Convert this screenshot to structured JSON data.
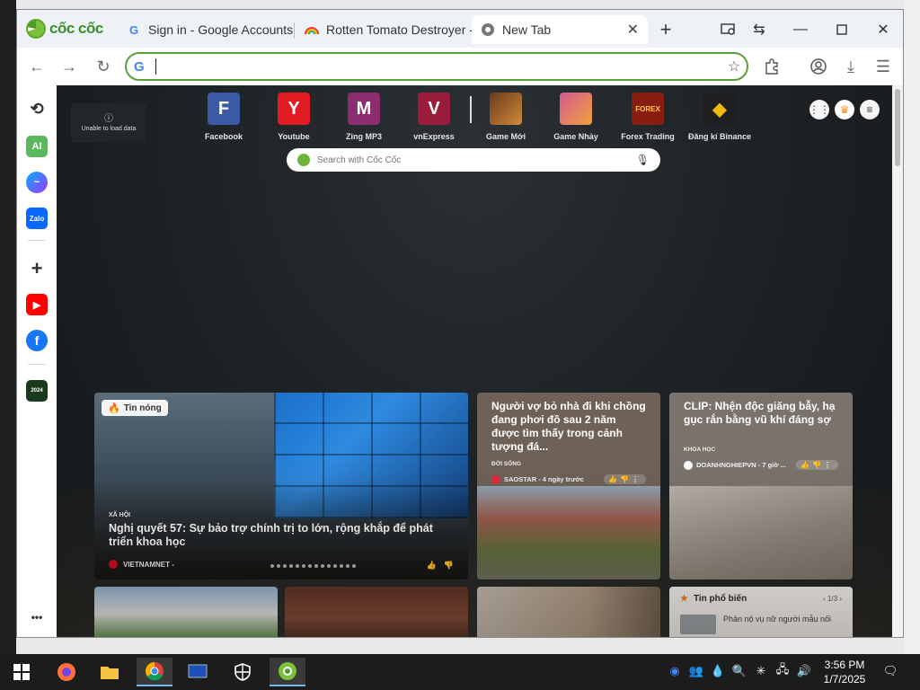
{
  "browser": {
    "brand": "cốc cốc",
    "tabs": [
      {
        "title": "Sign in - Google Accounts",
        "favicon": "google-g-icon"
      },
      {
        "title": "Rotten Tomato Destroyer -",
        "favicon": "rainbow-icon"
      },
      {
        "title": "New Tab",
        "favicon": "coccoc-icon",
        "active": true
      }
    ],
    "omnibox": {
      "value": "",
      "placeholder": ""
    }
  },
  "sidebar": {
    "ai_label": "AI",
    "zalo_label": "Zalo",
    "facebook_label": "f",
    "calendar_label": "2024",
    "more_label": "•••"
  },
  "ntp": {
    "load_error": "Unable to load data",
    "shortcuts": [
      {
        "label": "Facebook",
        "letter": "F",
        "color": "#3b5aa6"
      },
      {
        "label": "Youtube",
        "letter": "Y",
        "color": "#e21b23"
      },
      {
        "label": "Zing MP3",
        "letter": "M",
        "color": "#8b2d6e"
      },
      {
        "label": "vnExpress",
        "letter": "V",
        "color": "#9b1b3c"
      },
      {
        "label": "Game Mới",
        "letter": "",
        "color": "#6a3b1a"
      },
      {
        "label": "Game Nhảy",
        "letter": "",
        "color": "#d45a8a"
      },
      {
        "label": "Forex Trading",
        "letter": "FOREX",
        "color": "#8a1d12"
      },
      {
        "label": "Đăng kí Binance",
        "letter": "",
        "color": "#1f1f1f"
      }
    ],
    "search_placeholder": "Search with Cốc Cốc",
    "featured": {
      "badge": "Tin nóng",
      "category": "XÃ HỘI",
      "title": "Nghị quyết 57: Sự bảo trợ chính trị to lớn, rộng khắp để phát triển khoa học",
      "source": "VIETNAMNET -"
    },
    "cards": [
      {
        "title": "Người vợ bỏ nhà đi khi chồng đang phơi đồ sau 2 năm được tìm thấy trong cảnh tượng đá...",
        "category": "ĐỜI SỐNG",
        "source": "SAOSTAR - 4 ngày trước"
      },
      {
        "title": "CLIP: Nhện độc giăng bẫy, hạ gục rắn bằng vũ khí đáng sợ",
        "category": "KHOA HỌC",
        "source": "DOANHNGHIEPVN - 7 giờ ..."
      }
    ],
    "popular": {
      "title": "Tin phổ biến",
      "page": "1/3",
      "first_item": "Phản nộ vụ nữ người mẫu nối"
    }
  },
  "taskbar": {
    "time": "3:56 PM",
    "date": "1/7/2025"
  }
}
